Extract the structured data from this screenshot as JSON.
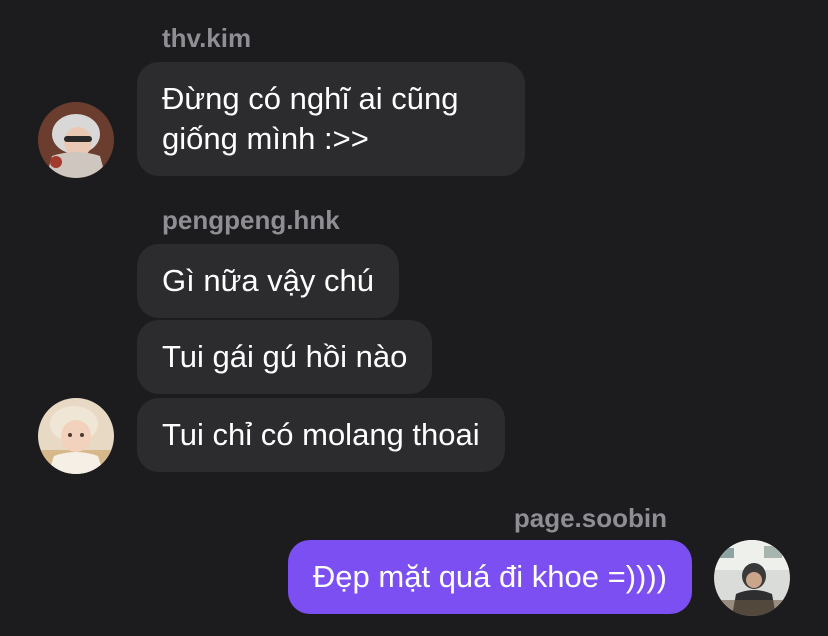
{
  "conversation": {
    "groups": [
      {
        "sender": "thv.kim",
        "avatar_icon": "user-avatar-thv-kim",
        "messages": [
          "Đừng có nghĩ ai cũng\ngiống mình :>>"
        ]
      },
      {
        "sender": "pengpeng.hnk",
        "avatar_icon": "user-avatar-pengpeng-hnk",
        "messages": [
          "Gì nữa vậy chú",
          "Tui gái gú hồi nào",
          "Tui chỉ có molang thoai"
        ]
      },
      {
        "sender": "page.soobin",
        "avatar_icon": "user-avatar-page-soobin",
        "messages": [
          "Đẹp mặt quá đi khoe =))))"
        ]
      }
    ]
  },
  "colors": {
    "background": "#1c1c1e",
    "incoming_bubble": "#2c2c2e",
    "outgoing_bubble": "#7b4ff1",
    "sender_name": "#8e8e93",
    "message_text": "#ffffff"
  }
}
